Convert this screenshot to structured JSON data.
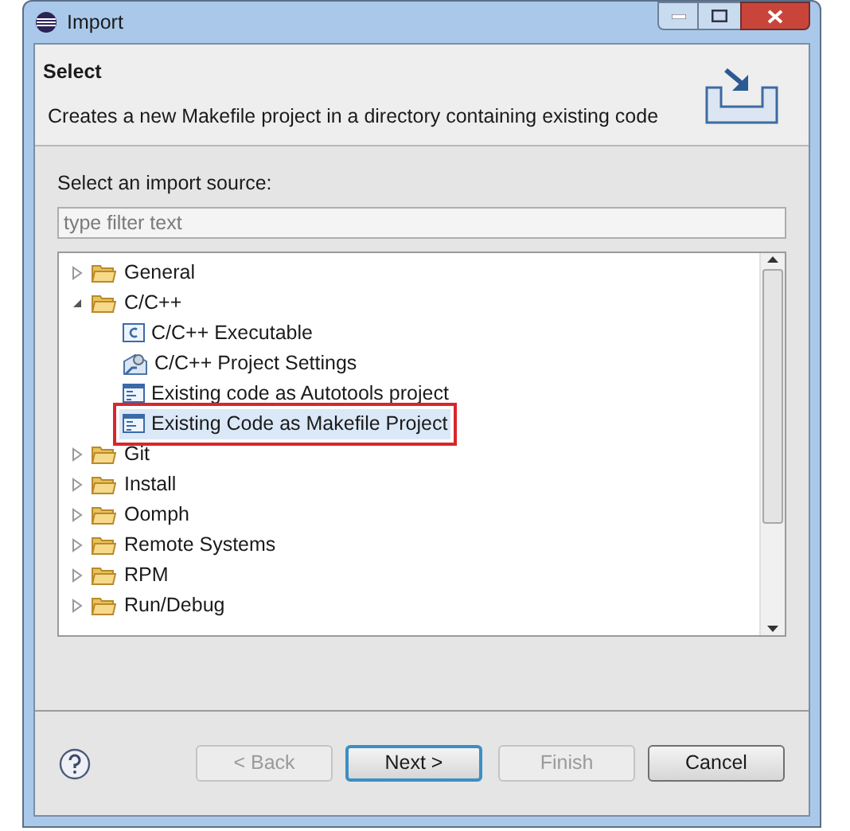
{
  "window": {
    "title": "Import"
  },
  "header": {
    "title": "Select",
    "description": "Creates a new Makefile project in a directory containing existing code"
  },
  "source_label": "Select an import source:",
  "filter": {
    "placeholder": "type filter text"
  },
  "tree": [
    {
      "label": "General",
      "kind": "folder",
      "expanded": false
    },
    {
      "label": "C/C++",
      "kind": "folder",
      "expanded": true,
      "children": [
        {
          "label": "C/C++ Executable",
          "kind": "exe",
          "selected": false,
          "highlighted": false
        },
        {
          "label": "C/C++ Project Settings",
          "kind": "settings",
          "selected": false,
          "highlighted": false
        },
        {
          "label": "Existing code as Autotools project",
          "kind": "code",
          "selected": false,
          "highlighted": false
        },
        {
          "label": "Existing Code as Makefile Project",
          "kind": "code",
          "selected": true,
          "highlighted": true
        }
      ]
    },
    {
      "label": "Git",
      "kind": "folder",
      "expanded": false
    },
    {
      "label": "Install",
      "kind": "folder",
      "expanded": false
    },
    {
      "label": "Oomph",
      "kind": "folder",
      "expanded": false
    },
    {
      "label": "Remote Systems",
      "kind": "folder",
      "expanded": false
    },
    {
      "label": "RPM",
      "kind": "folder",
      "expanded": false
    },
    {
      "label": "Run/Debug",
      "kind": "folder",
      "expanded": false
    }
  ],
  "buttons": [
    {
      "label": "< Back",
      "disabled": true,
      "default": false
    },
    {
      "label": "Next >",
      "disabled": false,
      "default": true
    },
    {
      "label": "Finish",
      "disabled": true,
      "default": false
    },
    {
      "label": "Cancel",
      "disabled": false,
      "default": false
    }
  ]
}
